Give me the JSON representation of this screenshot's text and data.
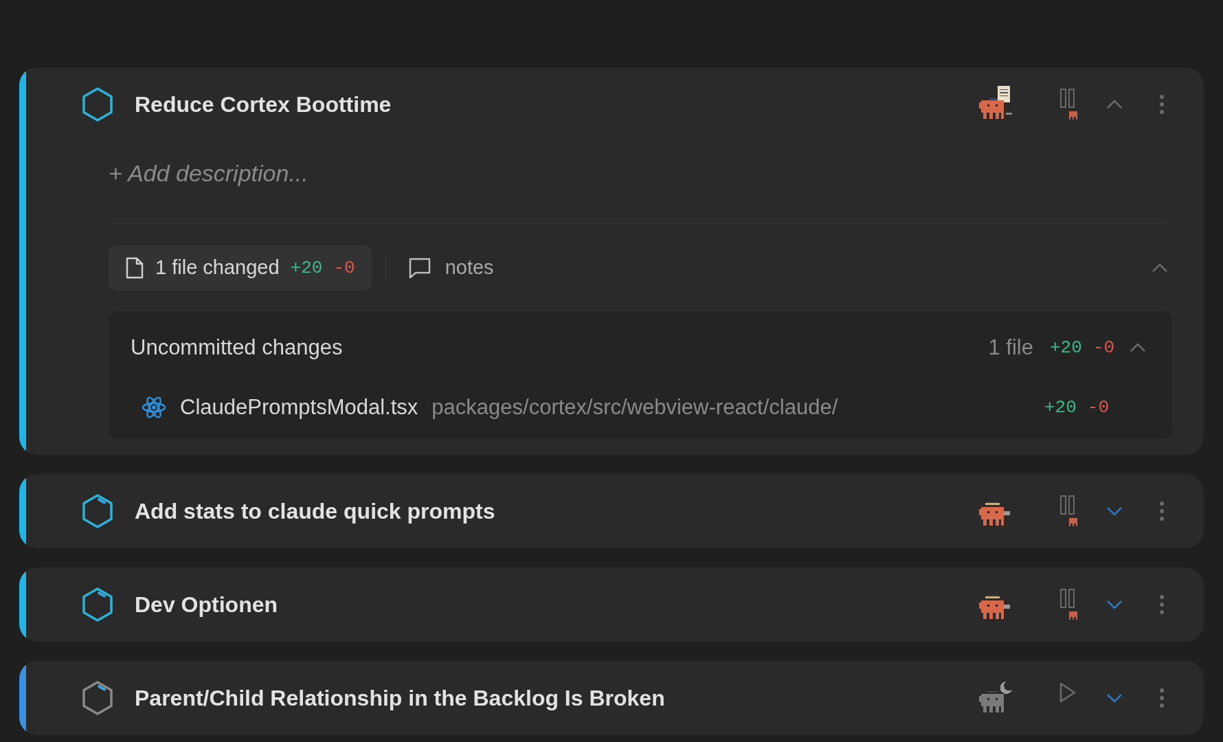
{
  "tasks": [
    {
      "title": "Reduce Cortex Boottime",
      "color": "#22b5e6",
      "active": true,
      "marked": false,
      "agent": {
        "kind": "writing"
      },
      "running": true,
      "expanded": true,
      "description_placeholder": "+ Add description...",
      "changes": {
        "label": "1 file changed",
        "added": "+20",
        "removed": "-0",
        "notes": "notes",
        "expanded": true,
        "group": {
          "title": "Uncommitted changes",
          "count": "1 file",
          "added": "+20",
          "removed": "-0",
          "expanded": true,
          "files": [
            {
              "name": "ClaudePromptsModal.tsx",
              "path": "packages/cortex/src/webview-react/claude/",
              "added": "+20",
              "removed": "-0"
            }
          ]
        }
      }
    },
    {
      "title": "Add stats to claude quick prompts",
      "color": "#22b5e6",
      "active": true,
      "marked": true,
      "agent": {
        "kind": "working"
      },
      "running": true,
      "expanded": false
    },
    {
      "title": "Dev Optionen",
      "color": "#22b5e6",
      "active": true,
      "marked": true,
      "agent": {
        "kind": "working"
      },
      "running": true,
      "expanded": false
    },
    {
      "title": "Parent/Child Relationship in the Backlog Is Broken",
      "color": "#3b8fe0",
      "active": false,
      "marked": true,
      "agent": {
        "kind": "sleeping"
      },
      "running": false,
      "expanded": false
    }
  ]
}
